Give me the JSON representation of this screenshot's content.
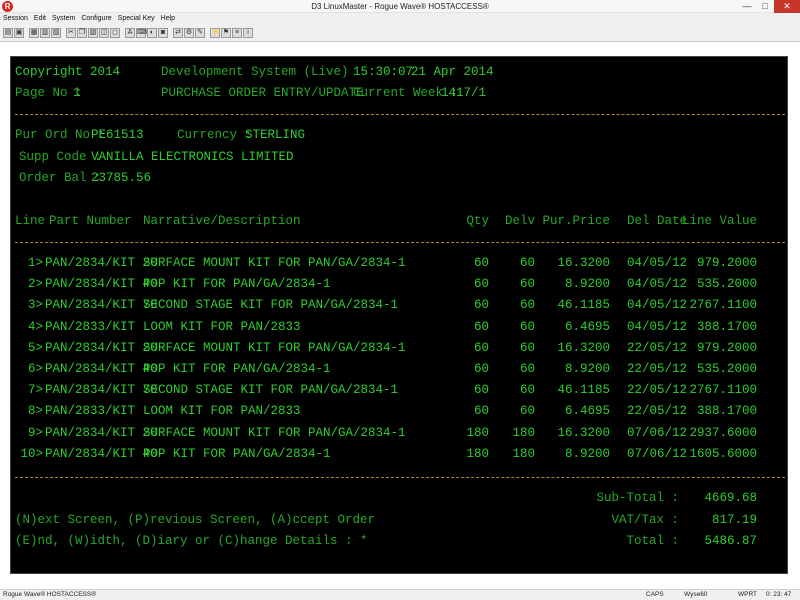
{
  "window": {
    "title": "D3 LinuxMaster - Rogue Wave® HOSTACCESS®",
    "minimize": "—",
    "maximize": "□",
    "close": "✕"
  },
  "menu": [
    "Session",
    "Edit",
    "System",
    "Configure",
    "Special Key",
    "Help"
  ],
  "toolbar_icons": [
    "new-session-icon",
    "open-icon",
    "save-icon",
    "print-icon",
    "print-screen-icon",
    "cut-icon",
    "copy-icon",
    "paste-icon",
    "select-all-icon",
    "clear-icon",
    "font-icon",
    "keyboard-icon",
    "colors-icon",
    "capture-icon",
    "transfer-icon",
    "settings-icon",
    "tools-icon",
    "macro-icon",
    "hotkey-icon",
    "script-icon",
    "info-icon"
  ],
  "terminal": {
    "copyright": "Copyright 2014",
    "system": "Development System (Live)",
    "time": "15:30:07",
    "date": "21 Apr 2014",
    "page_label": "Page No :",
    "page_no": "1",
    "screen_title": "PURCHASE ORDER ENTRY/UPDATE",
    "week_label": "Current Week :",
    "week": "1417/1",
    "order_label": "Pur Ord No :",
    "order_no": "PE61513",
    "currency_label": "Currency :",
    "currency": "STERLING",
    "supp_label": "Supp Code :",
    "supplier": "VANILLA ELECTRONICS LIMITED",
    "bal_label": "Order Bal :",
    "order_bal": "23785.56",
    "headers": {
      "line": "Line",
      "part": "Part Number",
      "narrative": "Narrative/Description",
      "qty": "Qty",
      "delv": "Delv",
      "price": "Pur.Price",
      "del_date": "Del Date",
      "value": "Line Value"
    },
    "rows": [
      {
        "no": "1>",
        "part": "PAN/2834/KIT 20",
        "desc": "SURFACE MOUNT KIT FOR PAN/GA/2834-1",
        "qty": "60",
        "delv": "60",
        "price": "16.3200",
        "date": "04/05/12",
        "value": "979.2000"
      },
      {
        "no": "2>",
        "part": "PAN/2834/KIT 40",
        "desc": "POP KIT FOR PAN/GA/2834-1",
        "qty": "60",
        "delv": "60",
        "price": "8.9200",
        "date": "04/05/12",
        "value": "535.2000"
      },
      {
        "no": "3>",
        "part": "PAN/2834/KIT 70",
        "desc": "SECOND STAGE KIT FOR PAN/GA/2834-1",
        "qty": "60",
        "delv": "60",
        "price": "46.1185",
        "date": "04/05/12",
        "value": "2767.1100"
      },
      {
        "no": "4>",
        "part": "PAN/2833/KIT",
        "desc": "LOOM KIT FOR PAN/2833",
        "qty": "60",
        "delv": "60",
        "price": "6.4695",
        "date": "04/05/12",
        "value": "388.1700"
      },
      {
        "no": "5>",
        "part": "PAN/2834/KIT 20",
        "desc": "SURFACE MOUNT KIT FOR PAN/GA/2834-1",
        "qty": "60",
        "delv": "60",
        "price": "16.3200",
        "date": "22/05/12",
        "value": "979.2000"
      },
      {
        "no": "6>",
        "part": "PAN/2834/KIT 40",
        "desc": "POP KIT FOR PAN/GA/2834-1",
        "qty": "60",
        "delv": "60",
        "price": "8.9200",
        "date": "22/05/12",
        "value": "535.2000"
      },
      {
        "no": "7>",
        "part": "PAN/2834/KIT 70",
        "desc": "SECOND STAGE KIT FOR PAN/GA/2834-1",
        "qty": "60",
        "delv": "60",
        "price": "46.1185",
        "date": "22/05/12",
        "value": "2767.1100"
      },
      {
        "no": "8>",
        "part": "PAN/2833/KIT",
        "desc": "LOOM KIT FOR PAN/2833",
        "qty": "60",
        "delv": "60",
        "price": "6.4695",
        "date": "22/05/12",
        "value": "388.1700"
      },
      {
        "no": "9>",
        "part": "PAN/2834/KIT 20",
        "desc": "SURFACE MOUNT KIT FOR PAN/GA/2834-1",
        "qty": "180",
        "delv": "180",
        "price": "16.3200",
        "date": "07/06/12",
        "value": "2937.6000"
      },
      {
        "no": "10>",
        "part": "PAN/2834/KIT 40",
        "desc": "POP KIT FOR PAN/GA/2834-1",
        "qty": "180",
        "delv": "180",
        "price": "8.9200",
        "date": "07/06/12",
        "value": "1605.6000"
      }
    ],
    "options_line1": "(N)ext Screen, (P)revious Screen, (A)ccept Order",
    "options_line2": "(E)nd, (W)idth, (D)iary or (C)hange Details : *",
    "subtotal_label": "Sub-Total :",
    "subtotal": "4669.68",
    "vat_label": "VAT/Tax :",
    "vat": "817.19",
    "total_label": "Total :",
    "total": "5486.87"
  },
  "status": {
    "app": "Rogue Wave® HOSTACCESS®",
    "caps": "CAPS",
    "emulation": "Wyse60",
    "mode": "WPRT",
    "clock": "0: 23: 47"
  }
}
